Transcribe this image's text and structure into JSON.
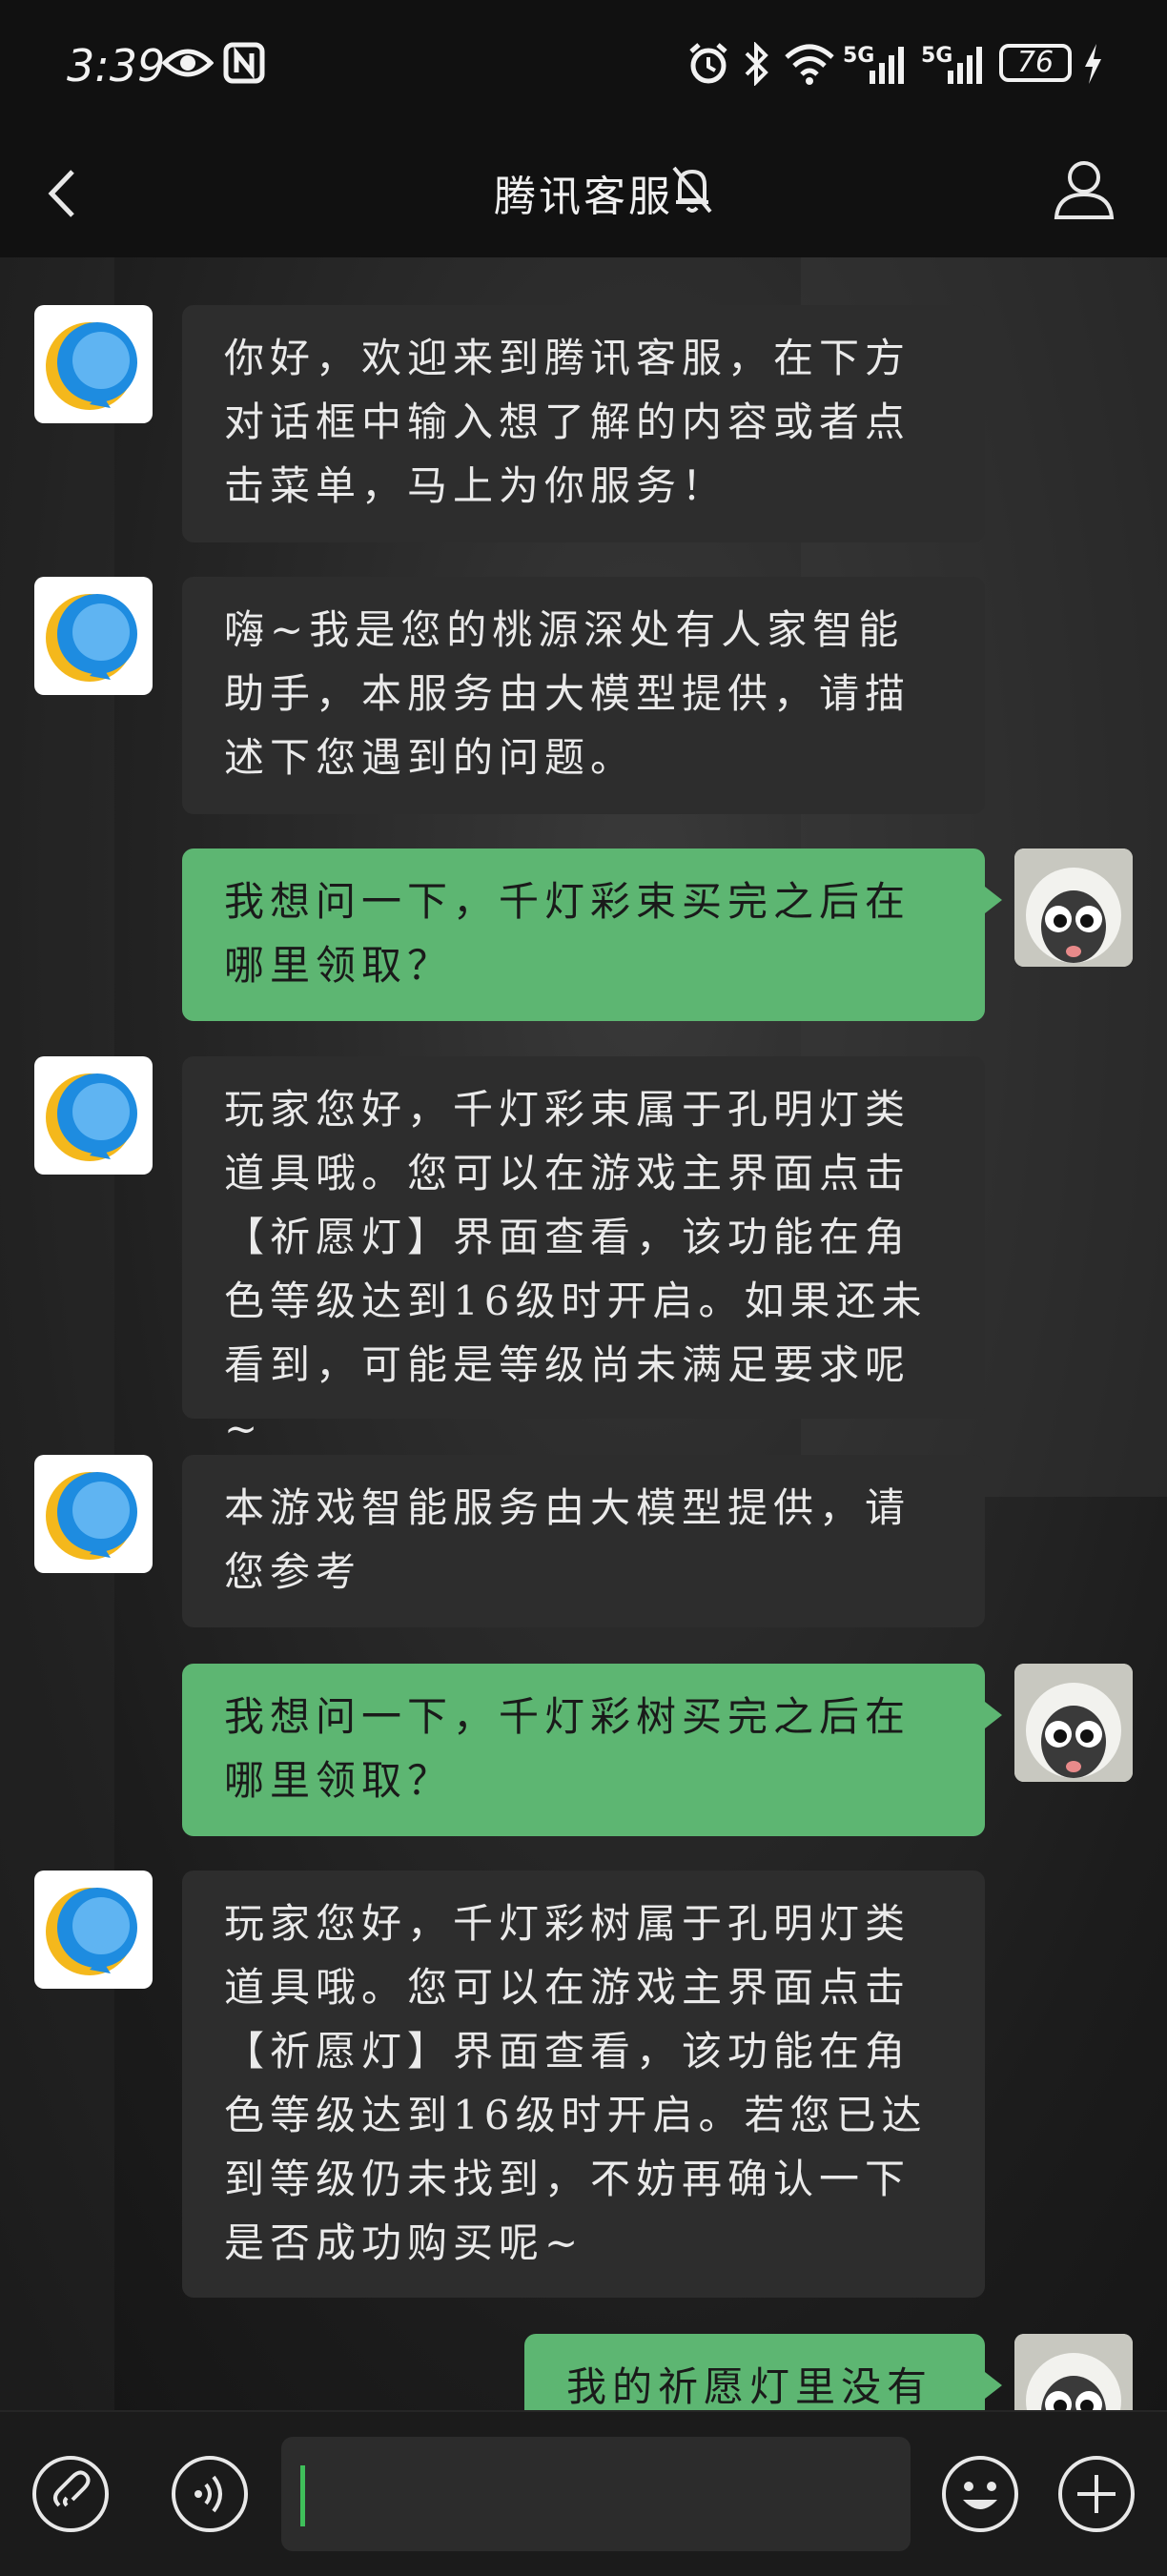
{
  "status_bar": {
    "time": "3:39",
    "network_1": "5G",
    "network_2": "5G",
    "battery": "76"
  },
  "header": {
    "title": "腾讯客服"
  },
  "messages": [
    {
      "sender": "bot",
      "text": "你好，欢迎来到腾讯客服，在下方对话框中输入想了解的内容或者点击菜单，马上为你服务！"
    },
    {
      "sender": "bot",
      "text": "嗨~我是您的桃源深处有人家智能助手，本服务由大模型提供，请描述下您遇到的问题。"
    },
    {
      "sender": "me",
      "text": "我想问一下，千灯彩束买完之后在哪里领取？"
    },
    {
      "sender": "bot",
      "text": "玩家您好，千灯彩束属于孔明灯类道具哦。您可以在游戏主界面点击【祈愿灯】界面查看，该功能在角色等级达到16级时开启。如果还未看到，可能是等级尚未满足要求呢~"
    },
    {
      "sender": "bot",
      "text": "本游戏智能服务由大模型提供，请您参考"
    },
    {
      "sender": "me",
      "text": "我想问一下，千灯彩树买完之后在哪里领取？"
    },
    {
      "sender": "bot",
      "text": "玩家您好，千灯彩树属于孔明灯类道具哦。您可以在游戏主界面点击【祈愿灯】界面查看，该功能在角色等级达到16级时开启。若您已达到等级仍未找到，不妨再确认一下是否成功购买呢~"
    },
    {
      "sender": "me",
      "text": "我的祈愿灯里没有"
    }
  ],
  "input": {
    "placeholder": ""
  },
  "colors": {
    "my_bubble": "#5db672",
    "bot_bubble": "#2d2d2d",
    "background": "#111111",
    "cursor": "#3fbf5a"
  },
  "icons": [
    "eye-icon",
    "nfc-icon",
    "alarm-icon",
    "bluetooth-icon",
    "wifi-icon",
    "signal-icon",
    "charging-icon",
    "back-icon",
    "mute-bell-icon",
    "profile-icon",
    "voice-mode-icon",
    "sound-icon",
    "emoji-icon",
    "plus-icon"
  ]
}
